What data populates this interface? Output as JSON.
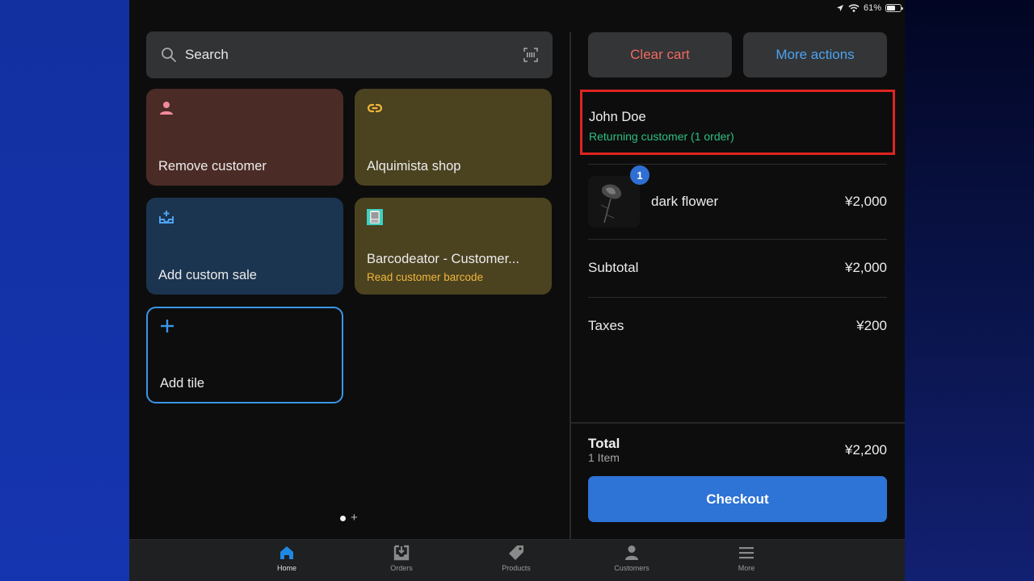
{
  "status_bar": {
    "battery_percent": "61%",
    "battery_level": 0.61,
    "icons": [
      "location-arrow-icon",
      "wifi-icon",
      "battery-icon"
    ]
  },
  "search": {
    "placeholder": "Search",
    "icon": "search-icon",
    "scanner_icon": "barcode-scan-icon"
  },
  "tiles": [
    {
      "title": "Remove customer",
      "icon": "person-icon",
      "color": "#4b2b26",
      "icon_color": "#f08a9a"
    },
    {
      "title": "Alquimista shop",
      "icon": "link-icon",
      "color": "#4b4220",
      "icon_color": "#f0b73a"
    },
    {
      "title": "Add custom sale",
      "icon": "tray-add-icon",
      "color": "#1b3450",
      "icon_color": "#4da3f0"
    },
    {
      "title": "Barcodeator - Customer...",
      "subtitle": "Read customer barcode",
      "icon": "barcode-app-icon",
      "color": "#4b4220"
    },
    {
      "title": "Add tile",
      "icon": "plus-icon",
      "icon_color": "#3a96e6"
    }
  ],
  "pager": {
    "pages": 1,
    "current": 1
  },
  "cart": {
    "clear_label": "Clear cart",
    "more_label": "More actions",
    "customer": {
      "name": "John Doe",
      "status": "Returning customer (1 order)"
    },
    "items": [
      {
        "name": "dark flower",
        "price": "¥2,000",
        "quantity": "1"
      }
    ],
    "subtotal_label": "Subtotal",
    "subtotal": "¥2,000",
    "taxes_label": "Taxes",
    "taxes": "¥200",
    "total_label": "Total",
    "item_count": "1 Item",
    "total": "¥2,200",
    "checkout_label": "Checkout"
  },
  "colors": {
    "accent": "#2e73d6",
    "clear": "#f06a5e",
    "more": "#4da3f0",
    "customer_status": "#2ebf83",
    "highlight": "#e0241f"
  },
  "tabbar": [
    {
      "label": "Home",
      "icon": "home-icon",
      "active": true
    },
    {
      "label": "Orders",
      "icon": "orders-inbox-icon",
      "active": false
    },
    {
      "label": "Products",
      "icon": "tag-icon",
      "active": false
    },
    {
      "label": "Customers",
      "icon": "person-icon",
      "active": false
    },
    {
      "label": "More",
      "icon": "menu-icon",
      "active": false
    }
  ]
}
